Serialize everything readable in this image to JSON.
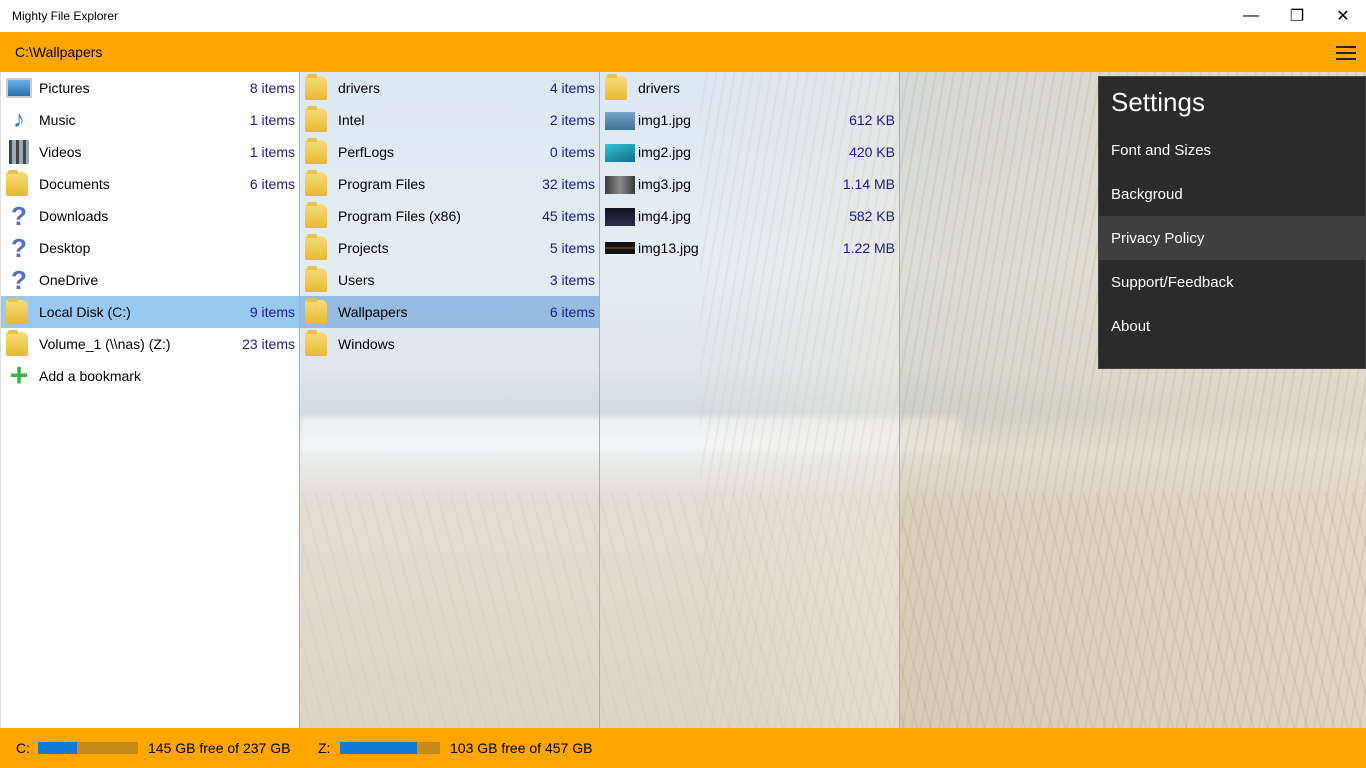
{
  "window": {
    "title": "Mighty File Explorer"
  },
  "window_controls": {
    "minimize": "—",
    "maximize": "❐",
    "close": "✕"
  },
  "path": "C:\\Wallpapers",
  "bookmarks": [
    {
      "label": "Pictures",
      "count": "8 items",
      "icon": "pictures-icon"
    },
    {
      "label": "Music",
      "count": "1 items",
      "icon": "music-icon"
    },
    {
      "label": "Videos",
      "count": "1 items",
      "icon": "videos-icon"
    },
    {
      "label": "Documents",
      "count": "6 items",
      "icon": "folder-icon"
    },
    {
      "label": "Downloads",
      "count": "",
      "icon": "question-icon"
    },
    {
      "label": "Desktop",
      "count": "",
      "icon": "question-icon"
    },
    {
      "label": "OneDrive",
      "count": "",
      "icon": "question-icon"
    },
    {
      "label": "Local Disk (C:)",
      "count": "9 items",
      "icon": "folder-icon"
    },
    {
      "label": "Volume_1 (\\\\nas) (Z:)",
      "count": "23 items",
      "icon": "folder-icon"
    },
    {
      "label": "Add a bookmark",
      "count": "",
      "icon": "plus-icon"
    }
  ],
  "drive_folders": [
    {
      "label": "drivers",
      "count": "4 items"
    },
    {
      "label": "Intel",
      "count": "2 items"
    },
    {
      "label": "PerfLogs",
      "count": "0 items"
    },
    {
      "label": "Program Files",
      "count": "32 items"
    },
    {
      "label": "Program Files (x86)",
      "count": "45 items"
    },
    {
      "label": "Projects",
      "count": "5 items"
    },
    {
      "label": "Users",
      "count": "3 items"
    },
    {
      "label": "Wallpapers",
      "count": "6 items"
    },
    {
      "label": "Windows",
      "count": ""
    }
  ],
  "wallpaper_files": [
    {
      "label": "drivers",
      "size": "",
      "type": "folder"
    },
    {
      "label": "img1.jpg",
      "size": "612 KB",
      "type": "image",
      "thumb_color": "#4a7fa8"
    },
    {
      "label": "img2.jpg",
      "size": "420 KB",
      "type": "image",
      "thumb_color": "#1b9fb8"
    },
    {
      "label": "img3.jpg",
      "size": "1.14 MB",
      "type": "image",
      "thumb_color": "#6a6a6a"
    },
    {
      "label": "img4.jpg",
      "size": "582 KB",
      "type": "image",
      "thumb_color": "#1a1d2a"
    },
    {
      "label": "img13.jpg",
      "size": "1.22 MB",
      "type": "image",
      "thumb_color": "#2a2218"
    }
  ],
  "settings": {
    "title": "Settings",
    "items": [
      "Font and Sizes",
      "Backgroud",
      "Privacy Policy",
      "Support/Feedback",
      "About"
    ]
  },
  "status": {
    "drive_c": {
      "label": "C:",
      "text": "145 GB free of 237 GB",
      "used_fraction": 0.39
    },
    "drive_z": {
      "label": "Z:",
      "text": "103 GB free of 457 GB",
      "used_fraction": 0.77
    }
  },
  "colors": {
    "accent": "#ffa500",
    "selection": "#99c9f0",
    "count_text": "#1a1a8c",
    "settings_bg": "#2b2b2b"
  }
}
